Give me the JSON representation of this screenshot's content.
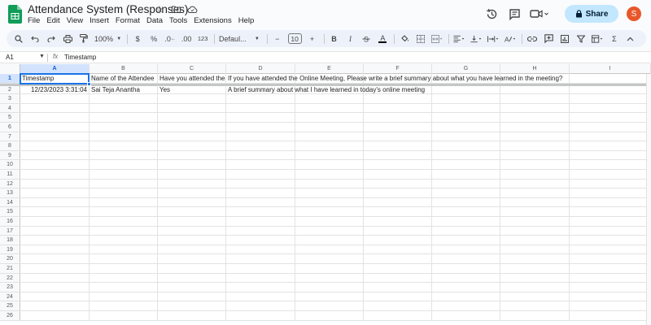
{
  "app": {
    "doc_title": "Attendance System (Responses)",
    "menu": [
      "File",
      "Edit",
      "View",
      "Insert",
      "Format",
      "Data",
      "Tools",
      "Extensions",
      "Help"
    ],
    "share_label": "Share",
    "avatar_letter": "S",
    "brand_color": "#0f9d58"
  },
  "toolbar": {
    "zoom": "100%",
    "currency": "$",
    "percent": "%",
    "dec_decrease": ".0",
    "dec_increase": ".00",
    "number_format": "123",
    "font": "Defaul...",
    "font_size": "10",
    "bold": "B",
    "italic": "I",
    "text_color": "A",
    "minus": "−",
    "plus": "+",
    "sigma": "Σ"
  },
  "formula_bar": {
    "cell_ref": "A1",
    "fx": "fx",
    "content": "Timestamp"
  },
  "sheet": {
    "columns": [
      "A",
      "B",
      "C",
      "D",
      "E",
      "F",
      "G",
      "H",
      "I"
    ],
    "rows": [
      {
        "num": "1",
        "cells": [
          "Timestamp",
          "Name of the Attendee",
          "Have you attended the O",
          "If you have attended the Online Meeting, Please write a brief summary about what you have learned in the meeting?",
          "",
          "",
          "",
          "",
          ""
        ]
      },
      {
        "num": "2",
        "cells": [
          "12/23/2023 3:31:04",
          "Sai Teja Anantha",
          "Yes",
          "A brief summary about what I have learned in today's online meeting",
          "",
          "",
          "",
          "",
          ""
        ]
      },
      {
        "num": "3",
        "cells": []
      },
      {
        "num": "4",
        "cells": []
      },
      {
        "num": "5",
        "cells": []
      },
      {
        "num": "6",
        "cells": []
      },
      {
        "num": "7",
        "cells": []
      },
      {
        "num": "8",
        "cells": []
      },
      {
        "num": "9",
        "cells": []
      },
      {
        "num": "10",
        "cells": []
      },
      {
        "num": "11",
        "cells": []
      },
      {
        "num": "12",
        "cells": []
      },
      {
        "num": "13",
        "cells": []
      },
      {
        "num": "14",
        "cells": []
      },
      {
        "num": "15",
        "cells": []
      },
      {
        "num": "16",
        "cells": []
      },
      {
        "num": "17",
        "cells": []
      },
      {
        "num": "18",
        "cells": []
      },
      {
        "num": "19",
        "cells": []
      },
      {
        "num": "20",
        "cells": []
      },
      {
        "num": "21",
        "cells": []
      },
      {
        "num": "22",
        "cells": []
      },
      {
        "num": "23",
        "cells": []
      },
      {
        "num": "24",
        "cells": []
      },
      {
        "num": "25",
        "cells": []
      },
      {
        "num": "26",
        "cells": []
      }
    ]
  }
}
